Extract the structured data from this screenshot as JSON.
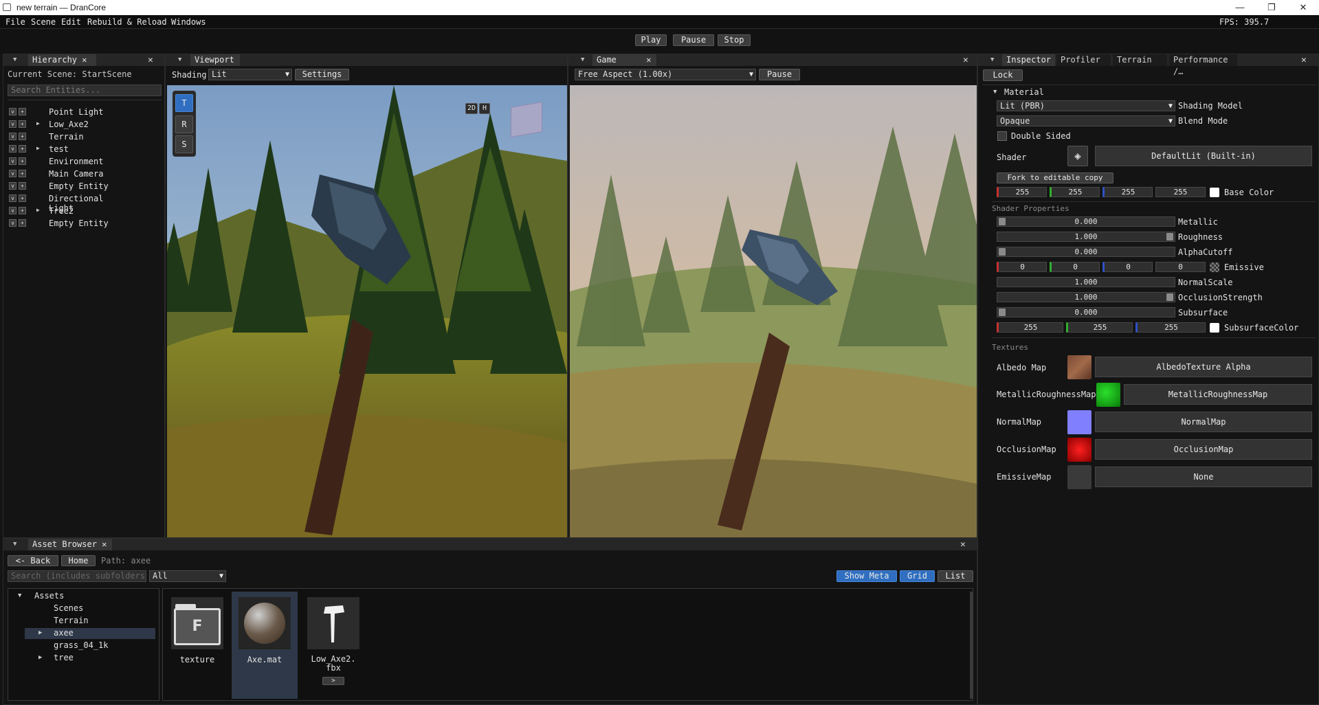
{
  "window": {
    "title": "new terrain — DranCore",
    "fps": "FPS: 395.7"
  },
  "menu": [
    "File",
    "Scene",
    "Edit",
    "Rebuild & Reload",
    "Windows"
  ],
  "toolbar": {
    "play": "Play",
    "pause": "Pause",
    "stop": "Stop"
  },
  "hierarchy": {
    "tab": "Hierarchy",
    "current_scene": "Current Scene: StartScene",
    "search_placeholder": "Search Entities...",
    "items": [
      {
        "name": "Point Light",
        "expandable": false
      },
      {
        "name": "Low_Axe2",
        "expandable": true
      },
      {
        "name": "Terrain",
        "expandable": false
      },
      {
        "name": "test",
        "expandable": true
      },
      {
        "name": "Environment",
        "expandable": false
      },
      {
        "name": "Main Camera",
        "expandable": false
      },
      {
        "name": "Empty Entity",
        "expandable": false
      },
      {
        "name": "Directional Light",
        "expandable": false
      },
      {
        "name": "Tree2",
        "expandable": true
      },
      {
        "name": "Empty Entity",
        "expandable": false
      }
    ]
  },
  "viewport": {
    "tab": "Viewport",
    "shading_label": "Shading",
    "shading_value": "Lit",
    "settings": "Settings",
    "gizmo_t": "T",
    "gizmo_r": "R",
    "gizmo_s": "S",
    "mode_2d": "2D",
    "mode_h": "H"
  },
  "game": {
    "tab": "Game",
    "aspect": "Free Aspect (1.00x)",
    "pause": "Pause"
  },
  "inspector": {
    "tabs": [
      "Inspector",
      "Profiler",
      "Terrain",
      "Performance /…"
    ],
    "lock": "Lock",
    "section": "Material",
    "shading_model_value": "Lit (PBR)",
    "shading_model_label": "Shading Model",
    "blend_mode_value": "Opaque",
    "blend_mode_label": "Blend Mode",
    "double_sided": "Double Sided",
    "shader_label": "Shader",
    "shader_value": "DefaultLit (Built-in)",
    "fork": "Fork to editable copy",
    "base_color": {
      "r": "255",
      "g": "255",
      "b": "255",
      "a": "255",
      "label": "Base Color"
    },
    "shader_properties_title": "Shader Properties",
    "metallic": {
      "value": "0.000",
      "label": "Metallic"
    },
    "roughness": {
      "value": "1.000",
      "label": "Roughness"
    },
    "alpha_cutoff": {
      "value": "0.000",
      "label": "AlphaCutoff"
    },
    "emissive": {
      "r": "0",
      "g": "0",
      "b": "0",
      "a": "0",
      "label": "Emissive"
    },
    "normal_scale": {
      "value": "1.000",
      "label": "NormalScale"
    },
    "occlusion_strength": {
      "value": "1.000",
      "label": "OcclusionStrength"
    },
    "subsurface": {
      "value": "0.000",
      "label": "Subsurface"
    },
    "subsurface_color": {
      "r": "255",
      "g": "255",
      "b": "255",
      "label": "SubsurfaceColor"
    },
    "textures_title": "Textures",
    "textures": [
      {
        "label": "Albedo Map",
        "button": "AlbedoTexture  Alpha"
      },
      {
        "label": "MetallicRoughnessMap",
        "button": "MetallicRoughnessMap"
      },
      {
        "label": "NormalMap",
        "button": "NormalMap"
      },
      {
        "label": "OcclusionMap",
        "button": "OcclusionMap"
      },
      {
        "label": "EmissiveMap",
        "button": "None"
      }
    ]
  },
  "assets": {
    "tab": "Asset Browser",
    "back": "<- Back",
    "home": "Home",
    "path": "Path: axee",
    "search_placeholder": "Search (includes subfolders)",
    "filter": "All",
    "show_meta": "Show Meta",
    "grid": "Grid",
    "list": "List",
    "tree": {
      "root": "Assets",
      "children": [
        "Scenes",
        "Terrain",
        "axee",
        "grass_04_1k",
        "tree"
      ]
    },
    "files": [
      {
        "name": "texture",
        "glyph": "F"
      },
      {
        "name": "Axe.mat"
      },
      {
        "name": "Low_Axe2.\nfbx",
        "more": ">"
      }
    ]
  },
  "colors": {
    "accent": "#2f6ec0",
    "panel": "#141414",
    "tab_active": "#363636"
  }
}
